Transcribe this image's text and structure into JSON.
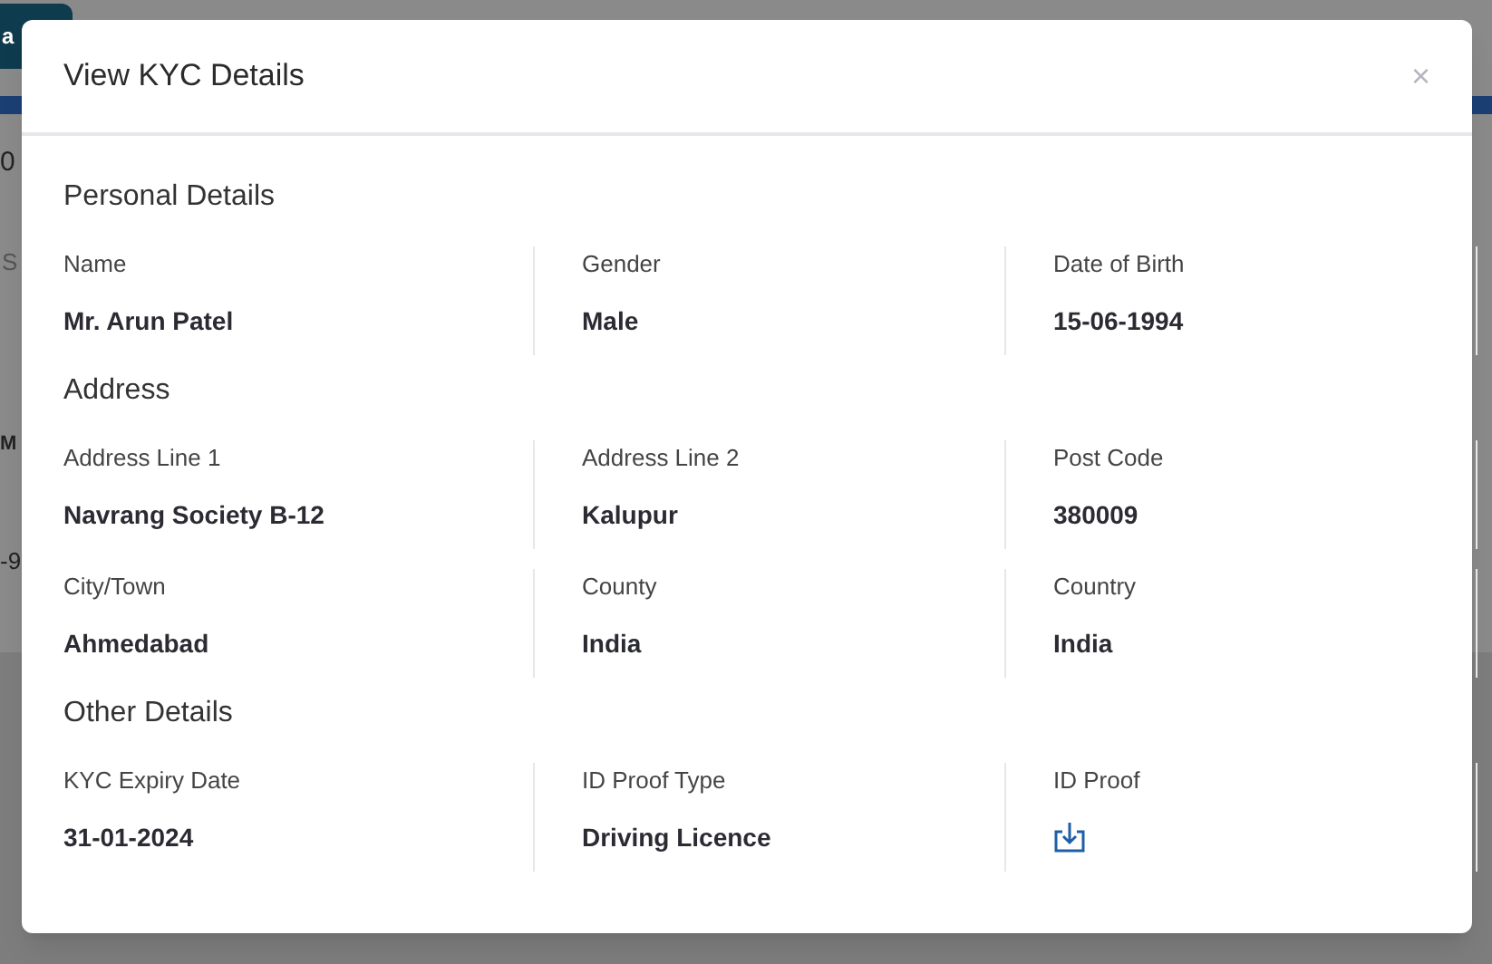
{
  "background": {
    "button": "a",
    "texts": [
      "0",
      "S",
      "M",
      "-9"
    ]
  },
  "modal": {
    "title": "View KYC Details",
    "close": "×",
    "sections": [
      {
        "title": "Personal Details",
        "rows": [
          [
            {
              "label": "Name",
              "value": "Mr. Arun Patel"
            },
            {
              "label": "Gender",
              "value": "Male"
            },
            {
              "label": "Date of Birth",
              "value": "15-06-1994"
            }
          ]
        ]
      },
      {
        "title": "Address",
        "rows": [
          [
            {
              "label": "Address Line 1",
              "value": "Navrang Society B-12"
            },
            {
              "label": "Address Line 2",
              "value": "Kalupur"
            },
            {
              "label": "Post Code",
              "value": "380009"
            }
          ],
          [
            {
              "label": "City/Town",
              "value": "Ahmedabad"
            },
            {
              "label": "County",
              "value": "India"
            },
            {
              "label": "Country",
              "value": "India"
            }
          ]
        ]
      },
      {
        "title": "Other Details",
        "rows": [
          [
            {
              "label": "KYC Expiry Date",
              "value": "31-01-2024"
            },
            {
              "label": "ID Proof Type",
              "value": "Driving Licence"
            },
            {
              "label": "ID Proof",
              "kind": "download"
            }
          ]
        ]
      }
    ]
  }
}
